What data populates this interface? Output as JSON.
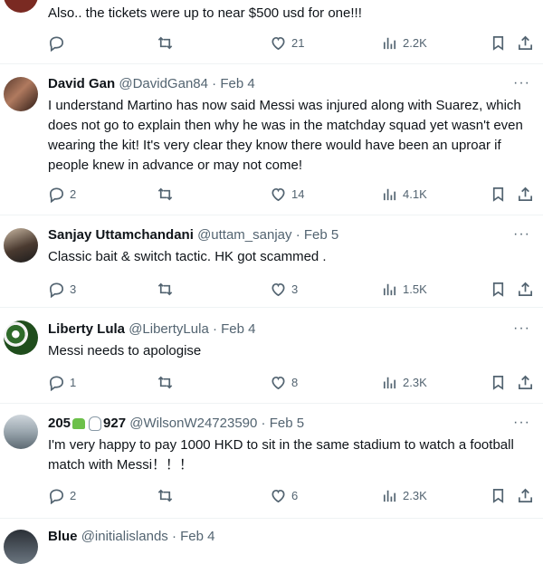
{
  "tweets": [
    {
      "text": "Also.. the tickets were up to near $500 usd for one!!!",
      "reply_count": "",
      "like_count": "21",
      "view_count": "2.2K"
    },
    {
      "name": "David Gan",
      "handle": "@DavidGan84",
      "date": "Feb 4",
      "text": "I understand Martino has now said Messi was injured along with Suarez, which does not go to explain then why he was in the matchday squad yet wasn't even wearing the kit! It's very clear they know there would have been an uproar if people knew in advance or may not come!",
      "reply_count": "2",
      "like_count": "14",
      "view_count": "4.1K"
    },
    {
      "name": "Sanjay Uttamchandani",
      "handle": "@uttam_sanjay",
      "date": "Feb 5",
      "text": "Classic bait & switch tactic. HK got scammed .",
      "reply_count": "3",
      "like_count": "3",
      "view_count": "1.5K"
    },
    {
      "name": "Liberty Lula",
      "handle": "@LibertyLula",
      "date": "Feb 4",
      "text": "Messi needs to apologise",
      "reply_count": "1",
      "like_count": "8",
      "view_count": "2.3K"
    },
    {
      "name_part1": "205",
      "name_part2": "927",
      "handle": "@WilsonW24723590",
      "date": "Feb 5",
      "text": "I'm very happy to pay 1000 HKD to sit in the same stadium to watch a football match with Messi！！！",
      "reply_count": "2",
      "like_count": "6",
      "view_count": "2.3K"
    },
    {
      "name": "Blue",
      "handle": "@initialislands",
      "date": "Feb 4"
    }
  ],
  "ui": {
    "separator": "·",
    "more_glyph": "···"
  },
  "colors": {
    "text_primary": "#0f1419",
    "text_secondary": "#536471",
    "divider": "#eff3f4"
  }
}
